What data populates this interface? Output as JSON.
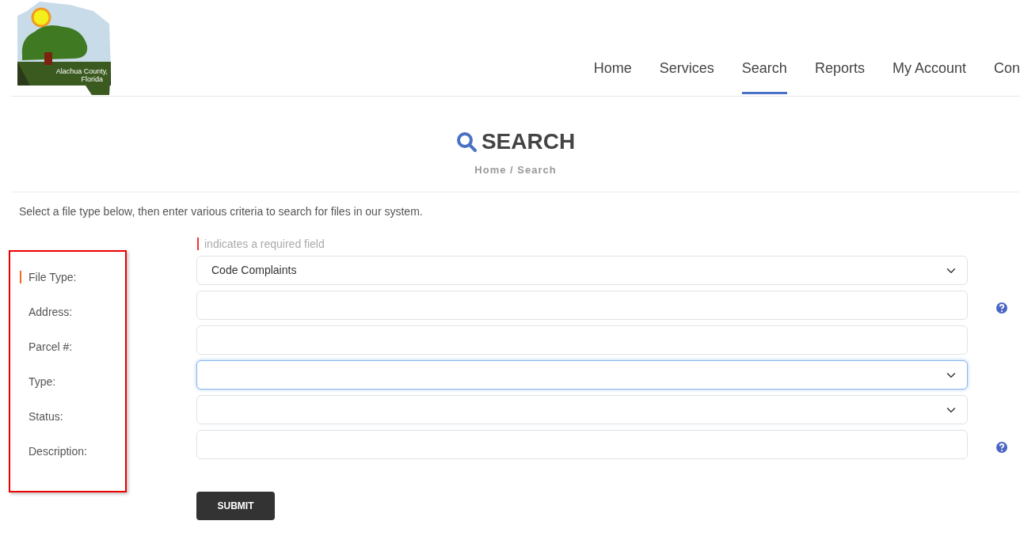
{
  "logo": {
    "lines": [
      "Alachua County,",
      "Florida"
    ]
  },
  "nav": [
    {
      "label": "Home",
      "selected": false
    },
    {
      "label": "Services",
      "selected": false
    },
    {
      "label": "Search",
      "selected": true
    },
    {
      "label": "Reports",
      "selected": false
    },
    {
      "label": "My Account",
      "selected": false
    },
    {
      "label": "Con",
      "selected": false
    }
  ],
  "page_title": "SEARCH",
  "breadcrumb": "Home / Search",
  "intro": "Select a file type below, then enter various criteria to search for files in our system.",
  "required_note": "indicates a required field",
  "fields": [
    {
      "label": "File Type:",
      "kind": "select",
      "value": "Code Complaints",
      "required": true,
      "focused": false,
      "help": false
    },
    {
      "label": "Address:",
      "kind": "text",
      "required": false,
      "focused": false,
      "help": true
    },
    {
      "label": "Parcel #:",
      "kind": "text",
      "required": false,
      "focused": false,
      "help": false
    },
    {
      "label": "Type:",
      "kind": "select",
      "required": false,
      "focused": true,
      "help": false
    },
    {
      "label": "Status:",
      "kind": "select",
      "required": false,
      "focused": false,
      "help": false
    },
    {
      "label": "Description:",
      "kind": "text",
      "required": false,
      "focused": false,
      "help": true
    }
  ],
  "submit": "SUBMIT"
}
